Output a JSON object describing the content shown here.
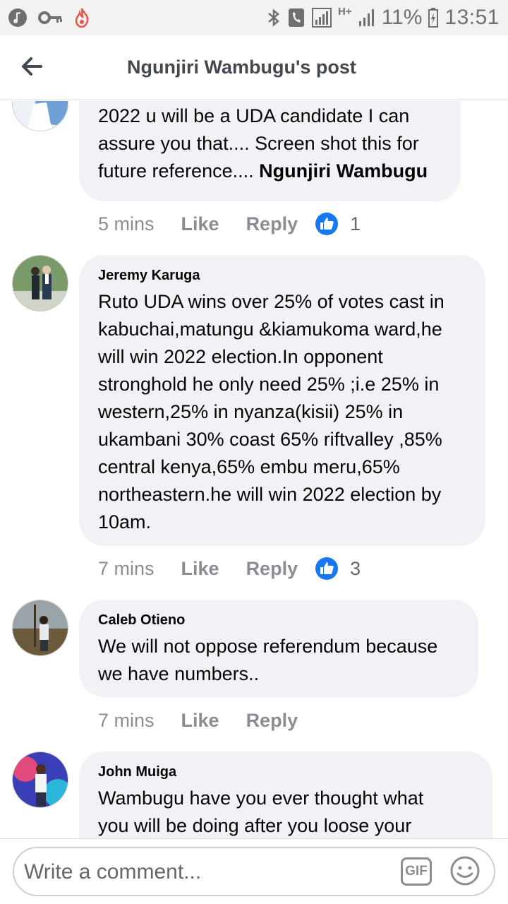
{
  "status_bar": {
    "network_type": "H+",
    "battery_percent": "11%",
    "time": "13:51"
  },
  "header": {
    "title": "Ngunjiri Wambugu's post"
  },
  "comments": [
    {
      "author": "",
      "text": "2022 u will be a UDA candidate I can\nassure you that.... Screen shot this for\nfuture reference.... ",
      "mention": "Ngunjiri Wambugu",
      "time": "5 mins",
      "like_label": "Like",
      "reply_label": "Reply",
      "reaction_count": "1"
    },
    {
      "author": "Jeremy Karuga",
      "text": "Ruto UDA wins over 25% of votes cast in\nkabuchai,matungu &kiamukoma ward,he\nwill win 2022 election.In opponent\nstronghold he only need 25% ;i.e 25% in\nwestern,25% in nyanza(kisii) 25% in\nukambani 30% coast 65% riftvalley ,85%\ncentral kenya,65% embu meru,65%\nnortheastern.he will win 2022 election by\n10am.",
      "time": "7 mins",
      "like_label": "Like",
      "reply_label": "Reply",
      "reaction_count": "3"
    },
    {
      "author": "Caleb Otieno",
      "text": "We will not oppose referendum because\nwe have numbers..",
      "time": "7 mins",
      "like_label": "Like",
      "reply_label": "Reply"
    },
    {
      "author": "John Muiga",
      "text": "Wambugu have you ever thought what\nyou will be doing after you loose your"
    }
  ],
  "composer": {
    "placeholder": "Write a comment...",
    "gif_label": "GIF"
  },
  "colors": {
    "like_blue": "#1877f2",
    "bubble_bg": "#f0f2f5",
    "meta_gray": "#8a8d91"
  }
}
